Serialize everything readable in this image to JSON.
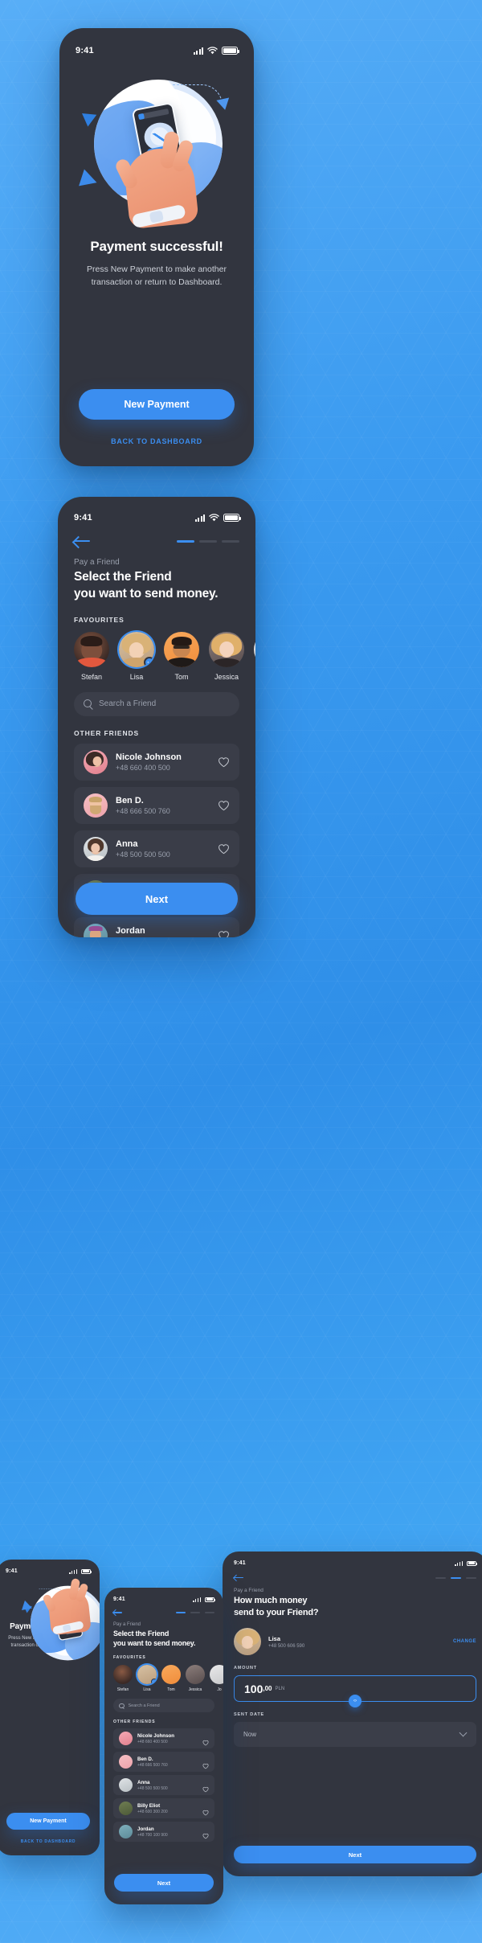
{
  "theme": {
    "accent": "#3b8ef0",
    "bg_blue": "#3b9bf0",
    "phone_bg": "#32353f",
    "card_bg": "#3a3d48",
    "text_primary": "#ffffff",
    "text_muted": "#9aa0ad"
  },
  "screen_success": {
    "status": {
      "time": "9:41",
      "signal_icon": "signal-bars-icon",
      "wifi_icon": "wifi-icon",
      "battery_icon": "battery-icon"
    },
    "illustration_name": "payment-success-illustration",
    "title": "Payment successful!",
    "subtitle": "Press New Payment to make another transaction or return to Dashboard.",
    "primary_button": "New Payment",
    "secondary_link": "BACK TO DASHBOARD"
  },
  "screen_select_friend": {
    "status": {
      "time": "9:41"
    },
    "back_icon": "back-arrow-icon",
    "steps": {
      "total": 3,
      "active_index": 0
    },
    "kicker": "Pay a Friend",
    "title_line1": "Select the Friend",
    "title_line2": "you want to send money.",
    "favourites_label": "FAVOURITES",
    "favourites": [
      {
        "name": "Stefan",
        "selected": false
      },
      {
        "name": "Lisa",
        "selected": true
      },
      {
        "name": "Tom",
        "selected": false
      },
      {
        "name": "Jessica",
        "selected": false
      },
      {
        "name": "Jo",
        "selected": false
      }
    ],
    "search": {
      "placeholder": "Search a Friend",
      "value": "",
      "icon": "search-icon"
    },
    "other_friends_label": "OTHER FRIENDS",
    "friends": [
      {
        "name": "Nicole Johnson",
        "phone": "+48 660 400 500",
        "favourite": false
      },
      {
        "name": "Ben D.",
        "phone": "+48 666 500 760",
        "favourite": false
      },
      {
        "name": "Anna",
        "phone": "+48 500 500 500",
        "favourite": false
      },
      {
        "name": "Billy Eliot",
        "phone": "+48 600 300 200",
        "favourite": false
      },
      {
        "name": "Jordan",
        "phone": "+48 700 100 900",
        "favourite": false
      }
    ],
    "next_button": "Next"
  },
  "screen_amount": {
    "status": {
      "time": "9:41"
    },
    "steps": {
      "total": 3,
      "active_index": 1
    },
    "kicker": "Pay a Friend",
    "title_line1": "How much money",
    "title_line2": "send to your Friend?",
    "payee": {
      "name": "Lisa",
      "phone": "+48 500 606 590",
      "change_label": "CHANGE"
    },
    "amount_label": "AMOUNT",
    "amount": {
      "integer": "100",
      "decimals": ",00",
      "currency": "PLN"
    },
    "sent_date_label": "SENT DATE",
    "sent_date_value": "Now",
    "next_button": "Next"
  }
}
